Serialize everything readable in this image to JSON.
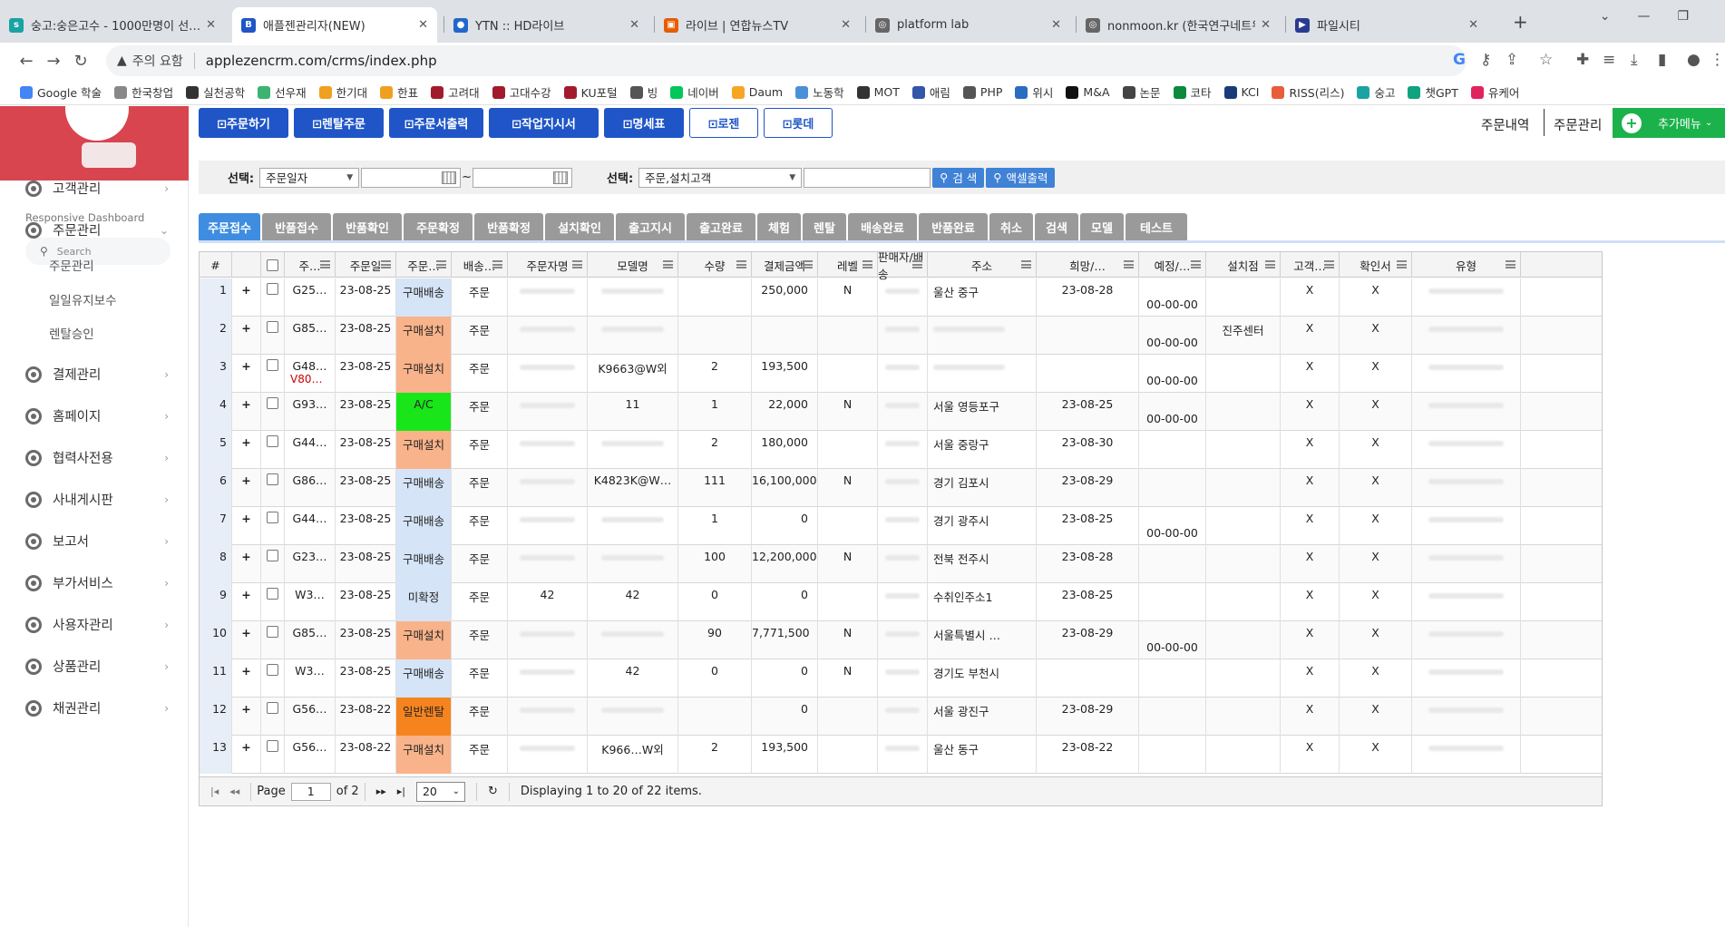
{
  "browser": {
    "tabs": [
      {
        "title": "숭고:숭은고수 - 1000만명이 선…",
        "fav_color": "#1aa3a3",
        "fav_text": "s"
      },
      {
        "title": "애플젠관리자(NEW)",
        "fav_color": "#1f55c7",
        "fav_text": "B"
      },
      {
        "title": "YTN :: HD라이브",
        "fav_color": "#2266cc",
        "fav_text": "●"
      },
      {
        "title": "라이브 | 연합뉴스TV",
        "fav_color": "#e65c00",
        "fav_text": "▣"
      },
      {
        "title": "platform lab",
        "fav_color": "#666666",
        "fav_text": "◎"
      },
      {
        "title": "nonmoon.kr (한국연구네트워크…",
        "fav_color": "#666666",
        "fav_text": "◎"
      },
      {
        "title": "파일시티",
        "fav_color": "#2a3b8f",
        "fav_text": "▶"
      }
    ],
    "new_tab": "+",
    "address": {
      "warning": "주의 요함",
      "url": "applezencrm.com/crms/index.php"
    },
    "bookmarks": [
      {
        "label": "Google 학술",
        "color": "#4285f4"
      },
      {
        "label": "한국창업",
        "color": "#888888"
      },
      {
        "label": "실천공학",
        "color": "#333333"
      },
      {
        "label": "선우재",
        "color": "#3cb371"
      },
      {
        "label": "한기대",
        "color": "#f0a020"
      },
      {
        "label": "한표",
        "color": "#f0a020"
      },
      {
        "label": "고려대",
        "color": "#a11b2c"
      },
      {
        "label": "고대수강",
        "color": "#a11b2c"
      },
      {
        "label": "KU포털",
        "color": "#a11b2c"
      },
      {
        "label": "빙",
        "color": "#555555"
      },
      {
        "label": "네이버",
        "color": "#03c75a"
      },
      {
        "label": "Daum",
        "color": "#f5a623"
      },
      {
        "label": "노동학",
        "color": "#4a90d9"
      },
      {
        "label": "MOT",
        "color": "#333333"
      },
      {
        "label": "애림",
        "color": "#3355aa"
      },
      {
        "label": "PHP",
        "color": "#555555"
      },
      {
        "label": "위시",
        "color": "#2a6cc1"
      },
      {
        "label": "M&A",
        "color": "#111111"
      },
      {
        "label": "논문",
        "color": "#444444"
      },
      {
        "label": "코타",
        "color": "#0a8a3a"
      },
      {
        "label": "KCI",
        "color": "#1a3b7a"
      },
      {
        "label": "RISS(리스)",
        "color": "#e85d3a"
      },
      {
        "label": "숭고",
        "color": "#1aa3a3"
      },
      {
        "label": "챗GPT",
        "color": "#10a37f"
      },
      {
        "label": "유케어",
        "color": "#e0245e"
      }
    ]
  },
  "sidebar": {
    "subtitle": "Responsive Dashboard",
    "search_placeholder": "Search",
    "menu": [
      {
        "label": "고객관리",
        "chev": "›"
      },
      {
        "label": "주문관리",
        "chev": "⌄"
      },
      {
        "label": "결제관리",
        "chev": "›"
      },
      {
        "label": "홈페이지",
        "chev": "›"
      },
      {
        "label": "협력사전용",
        "chev": "›"
      },
      {
        "label": "사내게시판",
        "chev": "›"
      },
      {
        "label": "보고서",
        "chev": "›"
      },
      {
        "label": "부가서비스",
        "chev": "›"
      },
      {
        "label": "사용자관리",
        "chev": "›"
      },
      {
        "label": "상품관리",
        "chev": "›"
      },
      {
        "label": "채권관리",
        "chev": "›"
      }
    ],
    "submenu": [
      "주문관리",
      "일일유지보수",
      "렌탈승인"
    ]
  },
  "toolbar": {
    "buttons": [
      "⊡주문하기",
      "⊡렌탈주문",
      "⊡주문서출력",
      "⊡작업지시서",
      "⊡명세표",
      "⊡로젠",
      "⊡롯데"
    ],
    "right_links": [
      "주문내역",
      "주문관리"
    ],
    "add_menu": "추가메뉴",
    "add_caret": "⌄"
  },
  "filter": {
    "label1": "선택:",
    "select1": "주문일자",
    "tilde": "~",
    "label2": "선택:",
    "select2": "주문,설치고객",
    "search_btn": "검 색",
    "excel_btn": "액셀출력"
  },
  "grid_tabs": [
    "주문접수",
    "반품접수",
    "반품확인",
    "주문확정",
    "반품확정",
    "설치확인",
    "출고지시",
    "출고완료",
    "체험",
    "렌탈",
    "배송완료",
    "반품완료",
    "취소",
    "검색",
    "모델",
    "테스트"
  ],
  "grid": {
    "columns": [
      "#",
      "",
      "",
      "주…",
      "주문일",
      "주문…",
      "배송…",
      "주문자명",
      "모델명",
      "수량",
      "결제금액",
      "레벨",
      "판매자/배송",
      "주소",
      "희망/…",
      "예정/…",
      "설치점",
      "고객…",
      "확인서",
      "유형"
    ],
    "rows": [
      {
        "n": "1",
        "code": "G25…",
        "code2": "",
        "date": "23-08-25",
        "type": "구매배송",
        "tcolor": "#d5e4f7",
        "ship": "주문",
        "model": "",
        "qty": "",
        "amt": "250,000",
        "lvl": "N",
        "addr": "울산 중구",
        "hope": "23-08-28",
        "sched": "00-00-00",
        "inst": "",
        "c1": "X",
        "c2": "X"
      },
      {
        "n": "2",
        "code": "G85…",
        "code2": "",
        "date": "23-08-25",
        "type": "구매설치",
        "tcolor": "#f9b38a",
        "ship": "주문",
        "model": "",
        "qty": "",
        "amt": "",
        "lvl": "",
        "addr": "",
        "hope": "",
        "sched": "00-00-00",
        "inst": "진주센터",
        "c1": "X",
        "c2": "X"
      },
      {
        "n": "3",
        "code": "G48…",
        "code2": "V80…",
        "date": "23-08-25",
        "type": "구매설치",
        "tcolor": "#f9b38a",
        "ship": "주문",
        "model": "K9663@W외",
        "qty": "2",
        "amt": "193,500",
        "lvl": "",
        "addr": "",
        "hope": "",
        "sched": "00-00-00",
        "inst": "",
        "c1": "X",
        "c2": "X"
      },
      {
        "n": "4",
        "code": "G93…",
        "code2": "",
        "date": "23-08-25",
        "type": "A/C",
        "tcolor": "#19e619",
        "ship": "주문",
        "model": "11",
        "qty": "1",
        "amt": "22,000",
        "lvl": "N",
        "addr": "서울 영등포구",
        "hope": "23-08-25",
        "sched": "00-00-00",
        "inst": "",
        "c1": "X",
        "c2": "X"
      },
      {
        "n": "5",
        "code": "G44…",
        "code2": "",
        "date": "23-08-25",
        "type": "구매설치",
        "tcolor": "#f9b38a",
        "ship": "주문",
        "model": "",
        "qty": "2",
        "amt": "180,000",
        "lvl": "",
        "addr": "서울 중랑구",
        "hope": "23-08-30",
        "sched": "",
        "inst": "",
        "c1": "X",
        "c2": "X"
      },
      {
        "n": "6",
        "code": "G86…",
        "code2": "",
        "date": "23-08-25",
        "type": "구매배송",
        "tcolor": "#d5e4f7",
        "ship": "주문",
        "model": "K4823K@W…",
        "qty": "111",
        "amt": "16,100,000",
        "lvl": "N",
        "addr": "경기 김포시",
        "hope": "23-08-29",
        "sched": "",
        "inst": "",
        "c1": "X",
        "c2": "X"
      },
      {
        "n": "7",
        "code": "G44…",
        "code2": "",
        "date": "23-08-25",
        "type": "구매배송",
        "tcolor": "#d5e4f7",
        "ship": "주문",
        "model": "",
        "qty": "1",
        "amt": "0",
        "lvl": "",
        "addr": "경기 광주시",
        "hope": "23-08-25",
        "sched": "00-00-00",
        "inst": "",
        "c1": "X",
        "c2": "X"
      },
      {
        "n": "8",
        "code": "G23…",
        "code2": "",
        "date": "23-08-25",
        "type": "구매배송",
        "tcolor": "#d5e4f7",
        "ship": "주문",
        "model": "",
        "qty": "100",
        "amt": "12,200,000",
        "lvl": "N",
        "addr": "전북 전주시",
        "hope": "23-08-28",
        "sched": "",
        "inst": "",
        "c1": "X",
        "c2": "X"
      },
      {
        "n": "9",
        "code": "W3…",
        "code2": "",
        "date": "23-08-25",
        "type": "미확정",
        "tcolor": "#d5e4f7",
        "ship": "주문",
        "cust": "42",
        "model": "42",
        "qty": "0",
        "amt": "0",
        "lvl": "",
        "addr": "수취인주소1",
        "hope": "23-08-25",
        "sched": "",
        "inst": "",
        "c1": "X",
        "c2": "X"
      },
      {
        "n": "10",
        "code": "G85…",
        "code2": "",
        "date": "23-08-25",
        "type": "구매설치",
        "tcolor": "#f9b38a",
        "ship": "주문",
        "model": "",
        "qty": "90",
        "amt": "7,771,500",
        "lvl": "N",
        "addr": "서울특별시 …",
        "hope": "23-08-29",
        "sched": "00-00-00",
        "inst": "",
        "c1": "X",
        "c2": "X"
      },
      {
        "n": "11",
        "code": "W3…",
        "code2": "",
        "date": "23-08-25",
        "type": "구매배송",
        "tcolor": "#d5e4f7",
        "ship": "주문",
        "model": "42",
        "qty": "0",
        "amt": "0",
        "lvl": "N",
        "addr": "경기도 부천시",
        "hope": "",
        "sched": "",
        "inst": "",
        "c1": "X",
        "c2": "X"
      },
      {
        "n": "12",
        "code": "G56…",
        "code2": "",
        "date": "23-08-22",
        "type": "일반렌탈",
        "tcolor": "#f5841f",
        "ship": "주문",
        "model": "",
        "qty": "",
        "amt": "0",
        "lvl": "",
        "addr": "서울 광진구",
        "hope": "23-08-29",
        "sched": "",
        "inst": "",
        "c1": "X",
        "c2": "X"
      },
      {
        "n": "13",
        "code": "G56…",
        "code2": "",
        "date": "23-08-22",
        "type": "구매설치",
        "tcolor": "#f9b38a",
        "ship": "주문",
        "model": "K966…W외",
        "qty": "2",
        "amt": "193,500",
        "lvl": "",
        "addr": "울산 동구",
        "hope": "23-08-22",
        "sched": "",
        "inst": "",
        "c1": "X",
        "c2": "X"
      }
    ]
  },
  "pager": {
    "page_label": "Page",
    "page_value": "1",
    "of_label": "of 2",
    "size": "20",
    "info": "Displaying 1 to 20 of 22 items."
  }
}
